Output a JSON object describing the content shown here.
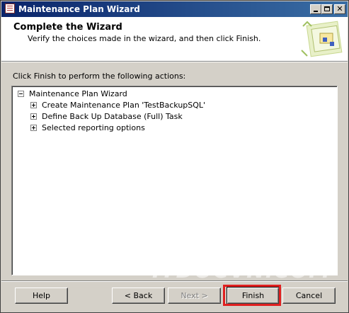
{
  "window": {
    "title": "Maintenance Plan Wizard"
  },
  "header": {
    "title": "Complete the Wizard",
    "subtitle": "Verify the choices made in the wizard, and then click Finish."
  },
  "main": {
    "prompt": "Click Finish to perform the following actions:",
    "tree": {
      "root": {
        "label": "Maintenance Plan Wizard",
        "expanded": true
      },
      "children": [
        {
          "label": "Create Maintenance Plan 'TestBackupSQL'",
          "expanded": false
        },
        {
          "label": "Define Back Up Database (Full) Task",
          "expanded": false
        },
        {
          "label": "Selected reporting options",
          "expanded": false
        }
      ]
    }
  },
  "watermark": "ITDOCVN.COM",
  "buttons": {
    "help": "Help",
    "back": "< Back",
    "next": "Next >",
    "finish": "Finish",
    "cancel": "Cancel"
  },
  "colors": {
    "highlight": "#e02020",
    "titlebar_start": "#0a246a",
    "titlebar_end": "#3a6ea5"
  }
}
